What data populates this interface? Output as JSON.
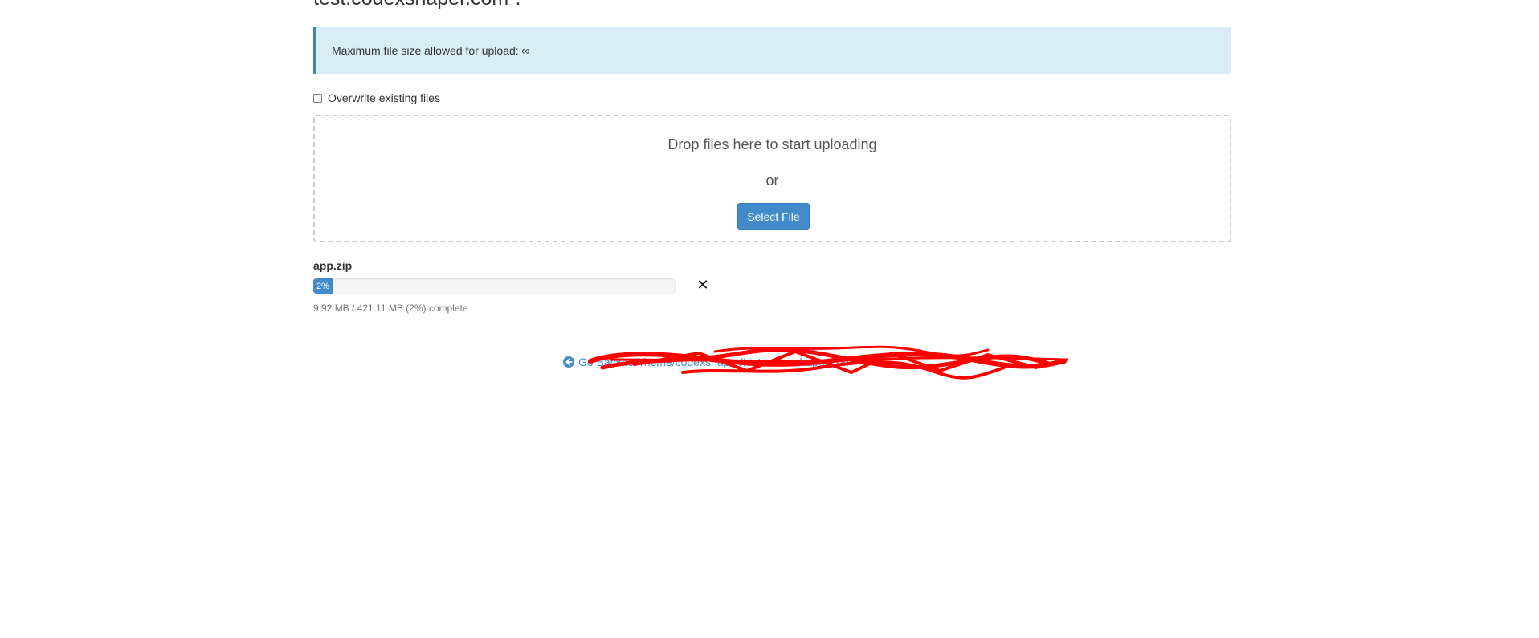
{
  "heading": {
    "text": "test.codexshaper.com”."
  },
  "alert": {
    "label": "Maximum file size allowed for upload:",
    "value": "∞"
  },
  "overwrite": {
    "label": "Overwrite existing files",
    "checked": false
  },
  "dropzone": {
    "title": "Drop files here to start uploading",
    "or": "or",
    "select_button": "Select File"
  },
  "upload": {
    "file_name": "app.zip",
    "progress_percent": 2,
    "progress_label": "2%",
    "status": "9.92 MB / 421.11 MB (2%) complete",
    "cancel_icon": "close-icon"
  },
  "footer": {
    "back_link": "Go Back to “/home/codexshaper/test.codexshaper.com”",
    "back_icon": "arrow-circle-left-icon",
    "redaction_color": "#ff0000"
  },
  "colors": {
    "primary": "#428bca",
    "alert_bg": "#d9edf7",
    "alert_border": "#3a87ad"
  }
}
